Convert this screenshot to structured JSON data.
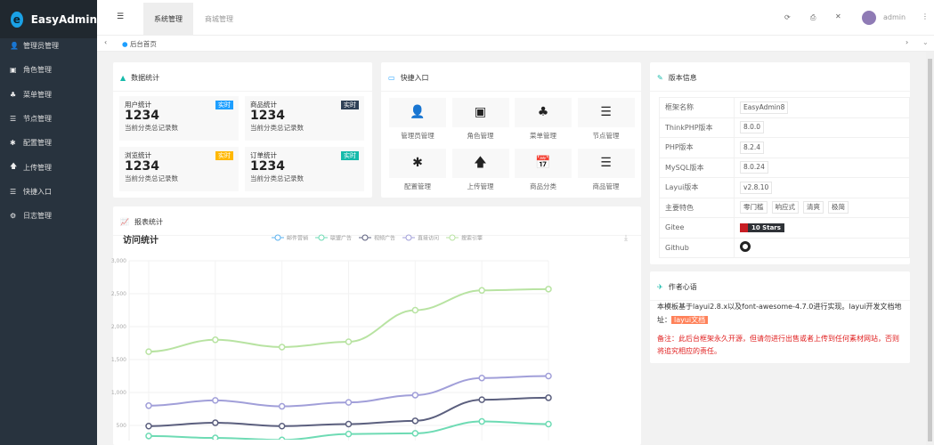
{
  "app": {
    "title": "EasyAdmin"
  },
  "sidebar": {
    "items": [
      {
        "label": "管理员管理",
        "icon": "user-icon"
      },
      {
        "label": "角色管理",
        "icon": "id-card-icon"
      },
      {
        "label": "菜单管理",
        "icon": "tree-icon"
      },
      {
        "label": "节点管理",
        "icon": "list-icon"
      },
      {
        "label": "配置管理",
        "icon": "asterisk-icon"
      },
      {
        "label": "上传管理",
        "icon": "arrow-up-icon"
      },
      {
        "label": "快捷入口",
        "icon": "list-icon"
      },
      {
        "label": "日志管理",
        "icon": "gear-icon"
      }
    ]
  },
  "header": {
    "tabs": [
      "系统管理",
      "商城管理"
    ],
    "user": "admin"
  },
  "tabbar": {
    "current": "后台首页"
  },
  "stats": {
    "title": "数据统计",
    "items": [
      {
        "title": "用户统计",
        "value": "1234",
        "desc": "当前分类总记录数",
        "badge": "实时",
        "color": "#1e9fff"
      },
      {
        "title": "商品统计",
        "value": "1234",
        "desc": "当前分类总记录数",
        "badge": "实时",
        "color": "#2f4056"
      },
      {
        "title": "浏览统计",
        "value": "1234",
        "desc": "当前分类总记录数",
        "badge": "实时",
        "color": "#ffb800"
      },
      {
        "title": "订单统计",
        "value": "1234",
        "desc": "当前分类总记录数",
        "badge": "实时",
        "color": "#16baaa"
      }
    ]
  },
  "quick": {
    "title": "快捷入口",
    "items": [
      {
        "label": "管理员管理",
        "glyph": "👤"
      },
      {
        "label": "角色管理",
        "glyph": "▣"
      },
      {
        "label": "菜单管理",
        "glyph": "♣"
      },
      {
        "label": "节点管理",
        "glyph": "☰"
      },
      {
        "label": "配置管理",
        "glyph": "✱"
      },
      {
        "label": "上传管理",
        "glyph": "🡅"
      },
      {
        "label": "商品分类",
        "glyph": "📅"
      },
      {
        "label": "商品管理",
        "glyph": "☰"
      }
    ]
  },
  "version": {
    "title": "版本信息",
    "rows": [
      {
        "k": "框架名称",
        "v": [
          "EasyAdmin8"
        ]
      },
      {
        "k": "ThinkPHP版本",
        "v": [
          "8.0.0"
        ]
      },
      {
        "k": "PHP版本",
        "v": [
          "8.2.4"
        ]
      },
      {
        "k": "MySQL版本",
        "v": [
          "8.0.24"
        ]
      },
      {
        "k": "Layui版本",
        "v": [
          "v2.8.10"
        ]
      },
      {
        "k": "主要特色",
        "v": [
          "零门槛",
          "响应式",
          "清爽",
          "极简"
        ]
      }
    ],
    "gitee_label": "Gitee",
    "gitee_badge": "10 Stars",
    "github_label": "Github"
  },
  "author": {
    "title": "作者心语",
    "text": "本模板基于layui2.8.x以及font-awesome-4.7.0进行实现。layui开发文档地址：",
    "link": "layui文档",
    "note": "备注：此后台框架永久开源，但请勿进行出售或者上传到任何素材网站，否则将追究相应的责任。"
  },
  "report": {
    "title": "报表统计"
  },
  "chart_data": {
    "type": "line",
    "title": "访问统计",
    "ylim": [
      0,
      3000
    ],
    "yticks": [
      500,
      1000,
      1500,
      2000,
      2500,
      3000
    ],
    "ytick_labels": [
      "500",
      "1,000",
      "1,500",
      "2,000",
      "2,500",
      "3,000"
    ],
    "grid": true,
    "legend": "top-center",
    "series": [
      {
        "name": "邮件营销",
        "color": "#5ab1ef",
        "values": []
      },
      {
        "name": "联盟广告",
        "color": "#6edbb4",
        "values": [
          340,
          310,
          280,
          370,
          380,
          560,
          520
        ]
      },
      {
        "name": "视频广告",
        "color": "#5b5f7e",
        "values": [
          490,
          540,
          490,
          520,
          570,
          890,
          920
        ]
      },
      {
        "name": "直接访问",
        "color": "#a19fd9",
        "values": [
          800,
          880,
          790,
          850,
          960,
          1220,
          1250
        ]
      },
      {
        "name": "搜索引擎",
        "color": "#b8e3a2",
        "values": [
          1620,
          1800,
          1690,
          1770,
          2250,
          2550,
          2570
        ]
      }
    ]
  }
}
